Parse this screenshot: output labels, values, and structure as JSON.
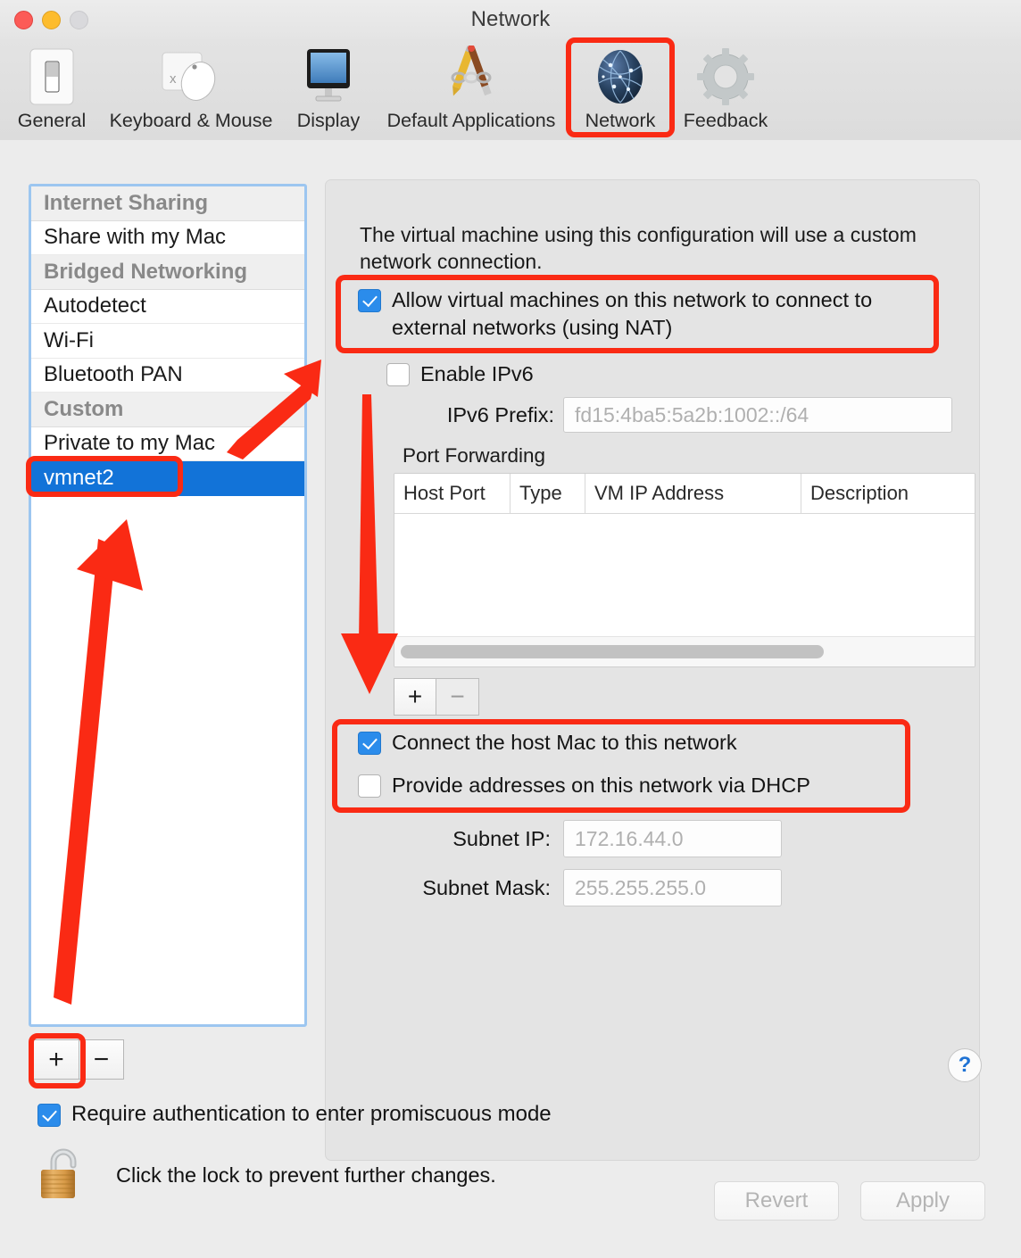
{
  "window": {
    "title": "Network",
    "traffic_lights": [
      "close",
      "minimize",
      "zoom"
    ]
  },
  "toolbar": {
    "items": [
      {
        "label": "General",
        "icon": "switch-icon",
        "selected": false
      },
      {
        "label": "Keyboard & Mouse",
        "icon": "mouse-icon",
        "selected": false
      },
      {
        "label": "Display",
        "icon": "monitor-icon",
        "selected": false
      },
      {
        "label": "Default Applications",
        "icon": "pencil-brush-icon",
        "selected": false
      },
      {
        "label": "Network",
        "icon": "globe-icon",
        "selected": true
      },
      {
        "label": "Feedback",
        "icon": "gear-icon",
        "selected": false
      }
    ]
  },
  "network_list": {
    "rows": [
      {
        "label": "Internet Sharing",
        "type": "header"
      },
      {
        "label": "Share with my Mac",
        "type": "item"
      },
      {
        "label": "Bridged Networking",
        "type": "header"
      },
      {
        "label": "Autodetect",
        "type": "item"
      },
      {
        "label": "Wi-Fi",
        "type": "item"
      },
      {
        "label": "Bluetooth PAN",
        "type": "item"
      },
      {
        "label": "Custom",
        "type": "header"
      },
      {
        "label": "Private to my Mac",
        "type": "item"
      },
      {
        "label": "vmnet2",
        "type": "item",
        "selected": true
      }
    ],
    "add_button": "+",
    "remove_button": "−"
  },
  "detail": {
    "description": "The virtual machine using this configuration will use a custom network connection.",
    "allow_nat": {
      "label": "Allow virtual machines on this network to connect to external networks (using NAT)",
      "checked": true
    },
    "enable_ipv6": {
      "label": "Enable IPv6",
      "checked": false
    },
    "ipv6_prefix": {
      "label": "IPv6 Prefix:",
      "value": "fd15:4ba5:5a2b:1002::/64"
    },
    "port_forwarding": {
      "title": "Port Forwarding",
      "columns": [
        "Host Port",
        "Type",
        "VM IP Address",
        "Description"
      ],
      "rows": [],
      "add_button": "+",
      "remove_button": "−"
    },
    "connect_host": {
      "label": "Connect the host Mac to this network",
      "checked": true
    },
    "provide_dhcp": {
      "label": "Provide addresses on this network via DHCP",
      "checked": false
    },
    "subnet_ip": {
      "label": "Subnet IP:",
      "value": "172.16.44.0"
    },
    "subnet_mask": {
      "label": "Subnet Mask:",
      "value": "255.255.255.0"
    },
    "help_button": "?"
  },
  "footer": {
    "promiscuous": {
      "label": "Require authentication to enter promiscuous mode",
      "checked": true
    },
    "lock_text": "Click the lock to prevent further changes.",
    "lock_icon": "unlocked-padlock-icon",
    "revert_button": "Revert",
    "apply_button": "Apply"
  },
  "annotations": {
    "accent_color": "#fa2a14",
    "highlight_boxes": [
      "network-toolbar-item",
      "vmnet2-list-row",
      "allow-nat-checkbox",
      "connect-host-dhcp-group",
      "list-add-button"
    ],
    "arrows": [
      "arrow-up-right-to-list",
      "arrow-down-to-add-port",
      "arrow-up-to-vmnet2"
    ]
  }
}
